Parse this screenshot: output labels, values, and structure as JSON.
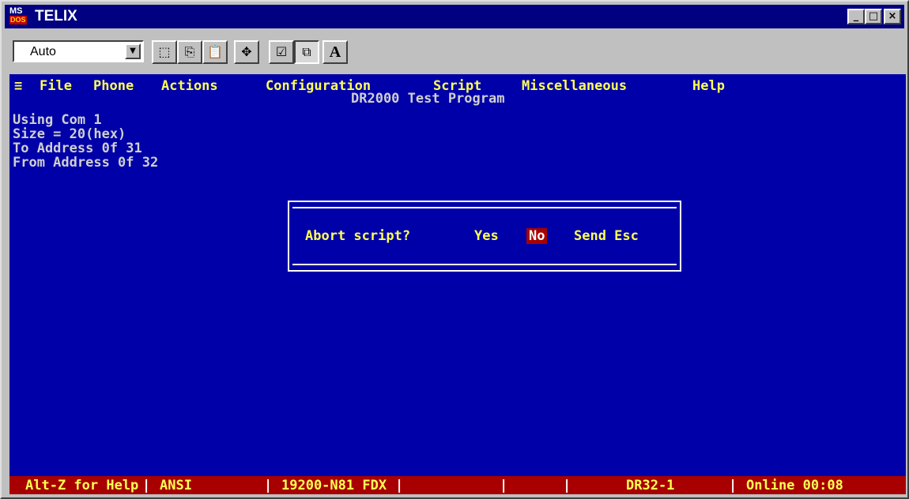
{
  "window": {
    "title": "TELIX",
    "icon_ms": "MS",
    "icon_dos": "DOS",
    "minimize": "_",
    "maximize": "□",
    "close": "×"
  },
  "toolbar": {
    "font_combo_value": "Auto",
    "font_combo_arrow": "▼",
    "buttons": {
      "mark": "⬚",
      "copy": "⎘",
      "paste": "📋",
      "fullscreen": "✥",
      "properties": "☑",
      "background": "⧉",
      "font": "A"
    }
  },
  "terminal": {
    "menu": {
      "system": "≡",
      "file": "File",
      "phone": "Phone",
      "actions": "Actions",
      "configuration": "Configuration",
      "script": "Script",
      "miscellaneous": "Miscellaneous",
      "help": "Help"
    },
    "screen_title": "DR2000 Test Program",
    "lines": [
      "Using Com 1",
      "Size = 20(hex)",
      "To Address 0f 31",
      "From Address 0f 32"
    ],
    "dialog": {
      "prompt": "Abort script?",
      "yes": "Yes",
      "no": "No",
      "send_esc": "Send Esc"
    },
    "status": {
      "help": "Alt-Z for Help",
      "emulation": "ANSI",
      "line_settings": "19200-N81 FDX",
      "empty": "",
      "script_name": "DR32-1",
      "online": "Online 00:08",
      "sep": "|"
    }
  },
  "colors": {
    "terminal_bg": "#0000a8",
    "menu_text": "#ffff55",
    "status_bg": "#a80000",
    "titlebar_bg": "#000080"
  }
}
